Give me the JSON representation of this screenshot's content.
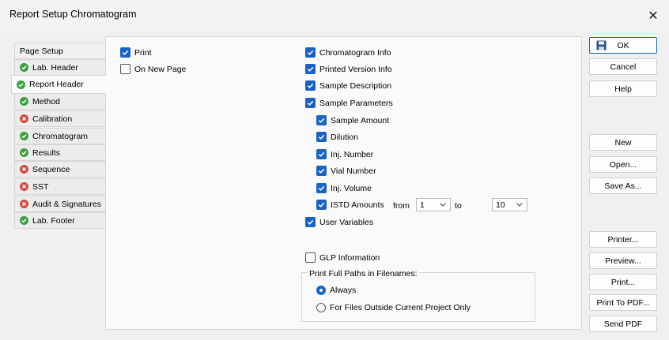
{
  "window": {
    "title": "Report Setup Chromatogram"
  },
  "tabs": [
    {
      "label": "Page Setup",
      "status": "none"
    },
    {
      "label": "Lab. Header",
      "status": "ok"
    },
    {
      "label": "Report Header",
      "status": "ok",
      "active": true
    },
    {
      "label": "Method",
      "status": "ok"
    },
    {
      "label": "Calibration",
      "status": "error"
    },
    {
      "label": "Chromatogram",
      "status": "ok"
    },
    {
      "label": "Results",
      "status": "ok"
    },
    {
      "label": "Sequence",
      "status": "error"
    },
    {
      "label": "SST",
      "status": "error"
    },
    {
      "label": "Audit & Signatures",
      "status": "error"
    },
    {
      "label": "Lab. Footer",
      "status": "ok"
    }
  ],
  "left_options": {
    "print": {
      "label": "Print",
      "checked": true
    },
    "on_new_page": {
      "label": "On New Page",
      "checked": false
    }
  },
  "right_options": {
    "chromatogram_info": {
      "label": "Chromatogram Info",
      "checked": true
    },
    "printed_version_info": {
      "label": "Printed Version Info",
      "checked": true
    },
    "sample_description": {
      "label": "Sample Description",
      "checked": true
    },
    "sample_parameters": {
      "label": "Sample Parameters",
      "checked": true
    },
    "sample_amount": {
      "label": "Sample Amount",
      "checked": true
    },
    "dilution": {
      "label": "Dilution",
      "checked": true
    },
    "inj_number": {
      "label": "Inj. Number",
      "checked": true
    },
    "vial_number": {
      "label": "Vial Number",
      "checked": true
    },
    "inj_volume": {
      "label": "Inj. Volume",
      "checked": true
    },
    "istd_amounts": {
      "label": "ISTD Amounts",
      "checked": true,
      "from_label": "from",
      "from_value": "1",
      "to_label": "to",
      "to_value": "10"
    },
    "user_variables": {
      "label": "User Variables",
      "checked": true
    },
    "glp_information": {
      "label": "GLP Information",
      "checked": false
    }
  },
  "full_paths": {
    "group_label": "Print Full Paths in Filenames:",
    "always": {
      "label": "Always",
      "selected": true
    },
    "outside_only": {
      "label": "For Files Outside Current Project Only",
      "selected": false
    }
  },
  "buttons": {
    "ok": "OK",
    "cancel": "Cancel",
    "help": "Help",
    "new": "New",
    "open": "Open...",
    "save_as": "Save As...",
    "printer": "Printer...",
    "preview": "Preview...",
    "print": "Print...",
    "print_to_pdf": "Print To PDF...",
    "send_pdf": "Send PDF"
  },
  "colors": {
    "accent": "#1a63c6",
    "ok_status": "#3aa141",
    "error_status": "#d24b3e"
  }
}
